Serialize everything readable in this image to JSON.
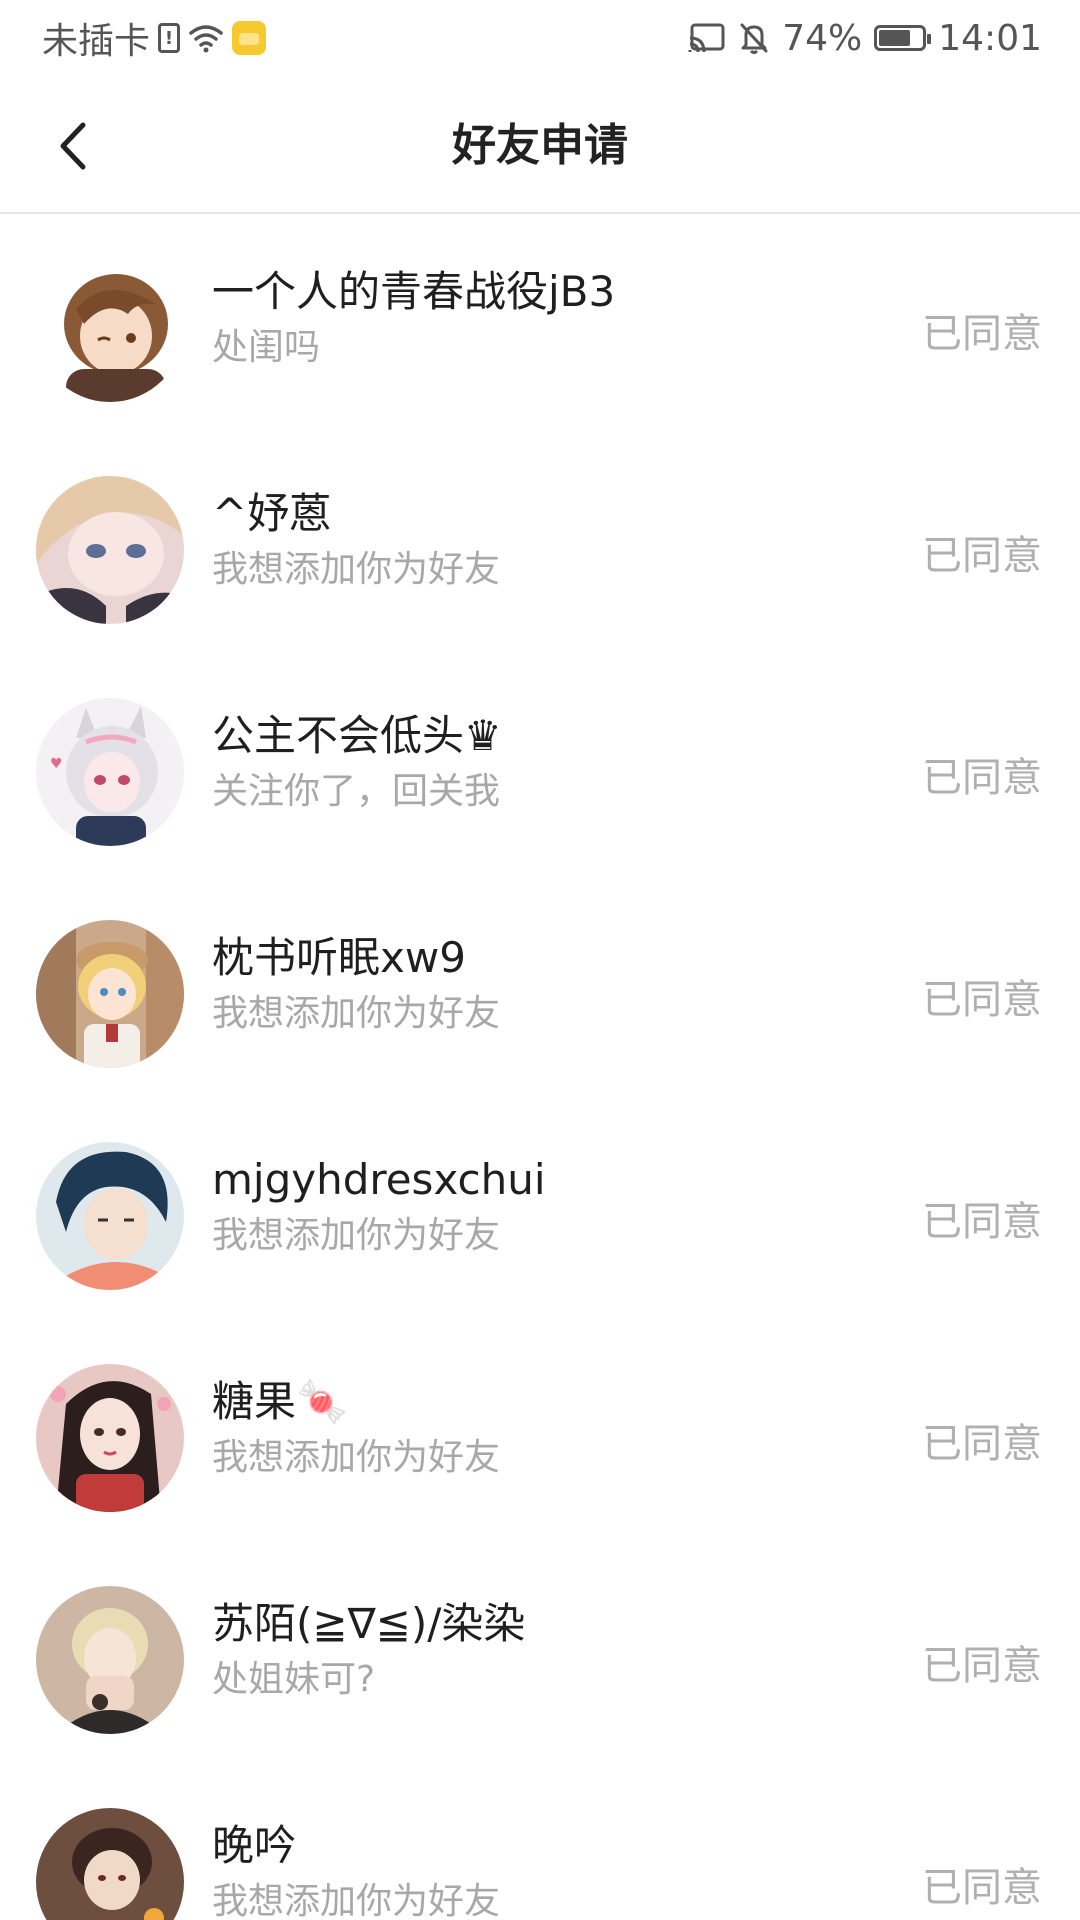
{
  "status_bar": {
    "carrier": "未插卡",
    "battery_percent": "74%",
    "battery_level": 0.74,
    "time": "14:01",
    "icons": [
      "sim-alert-icon",
      "wifi-icon",
      "wallet-icon",
      "cast-icon",
      "bell-off-icon",
      "battery-icon"
    ]
  },
  "header": {
    "title": "好友申请",
    "back_icon": "chevron-left-icon"
  },
  "requests": [
    {
      "name": "一个人的青春战役jB3",
      "message": "处闺吗",
      "status": "已同意"
    },
    {
      "name": "^妤蒽",
      "message": "我想添加你为好友",
      "status": "已同意"
    },
    {
      "name": "公主不会低头♛",
      "message": "关注你了，回关我",
      "status": "已同意"
    },
    {
      "name": "枕书听眠xw9",
      "message": "我想添加你为好友",
      "status": "已同意"
    },
    {
      "name": "mjgyhdresxchui",
      "message": "我想添加你为好友",
      "status": "已同意"
    },
    {
      "name": "糖果🍬",
      "message": "我想添加你为好友",
      "status": "已同意"
    },
    {
      "name": "苏陌(≧∇≦)/染染",
      "message": "处姐妹可?",
      "status": "已同意"
    },
    {
      "name": "晚吟",
      "message": "我想添加你为好友",
      "status": "已同意"
    }
  ],
  "colors": {
    "title": "#222222",
    "name": "#1f1f1f",
    "secondary": "#a8a8a8",
    "status": "#b0b0b0",
    "divider": "#e6e6e6"
  }
}
